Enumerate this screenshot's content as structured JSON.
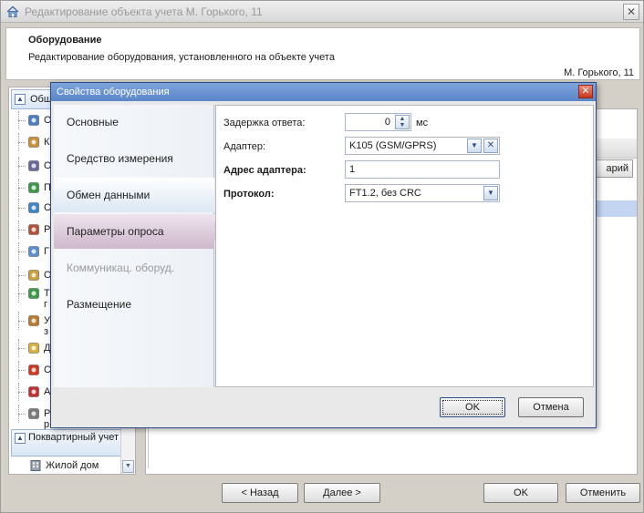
{
  "outer_window": {
    "title": "Редактирование объекта учета М. Горького, 11",
    "close_label": "✕"
  },
  "header": {
    "title": "Оборудование",
    "subtitle": "Редактирование оборудования, установленного на объекте учета",
    "address": "М. Горького, 11"
  },
  "tree": {
    "group1_label": "Общ",
    "items": [
      {
        "text": "О",
        "icon": "house-icon",
        "color": "#4a7fc4"
      },
      {
        "text": "К",
        "icon": "location-pin-icon",
        "color": "#c8913a"
      },
      {
        "text": "О",
        "icon": "meter-icon",
        "color": "#6a6a9a"
      },
      {
        "text": "П",
        "icon": "globe-icon",
        "color": "#3e9a48"
      },
      {
        "text": "С",
        "icon": "network-icon",
        "color": "#3b86c9"
      },
      {
        "text": "Р",
        "icon": "tools-icon",
        "color": "#b5533a"
      },
      {
        "text": "Г",
        "icon": "handshake-icon",
        "color": "#5b8fcf"
      },
      {
        "text": "О",
        "icon": "clipboard-icon",
        "color": "#c9a23c"
      },
      {
        "text": "Т г",
        "icon": "chart-icon",
        "color": "#3d9a4a"
      },
      {
        "text": "У з",
        "icon": "person-icon",
        "color": "#b97b2e"
      },
      {
        "text": "Д",
        "icon": "folder-icon",
        "color": "#d6b13f"
      },
      {
        "text": "С",
        "icon": "alarm-icon",
        "color": "#d13a22"
      },
      {
        "text": "А",
        "icon": "document-icon",
        "color": "#c23030"
      },
      {
        "text": "Р р",
        "icon": "calendar-icon",
        "color": "#7a7a7a"
      }
    ],
    "group2_label": "Поквартирный учет",
    "last_item": {
      "text": "Жилой дом",
      "icon": "building-icon"
    }
  },
  "right_pane": {
    "button_partial": "арий"
  },
  "bottom": {
    "back": "< Назад",
    "next": "Далее >",
    "ok": "OK",
    "cancel": "Отменить"
  },
  "dialog": {
    "title": "Свойства оборудования",
    "close_label": "✕",
    "nav": [
      {
        "label": "Основные",
        "state": "normal"
      },
      {
        "label": "Средство измерения",
        "state": "normal"
      },
      {
        "label": "Обмен данными",
        "state": "hover"
      },
      {
        "label": "Параметры опроса",
        "state": "active"
      },
      {
        "label": "Коммуникац. оборуд.",
        "state": "disabled"
      },
      {
        "label": "Размещение",
        "state": "normal"
      }
    ],
    "fields": {
      "delay_label": "Задержка ответа:",
      "delay_value": "0",
      "delay_unit": "мс",
      "adapter_label": "Адаптер:",
      "adapter_value": "K105 (GSM/GPRS)",
      "address_label": "Адрес адаптера:",
      "address_value": "1",
      "protocol_label": "Протокол:",
      "protocol_value": "FT1.2, без CRC"
    },
    "ok": "OK",
    "cancel": "Отмена"
  }
}
